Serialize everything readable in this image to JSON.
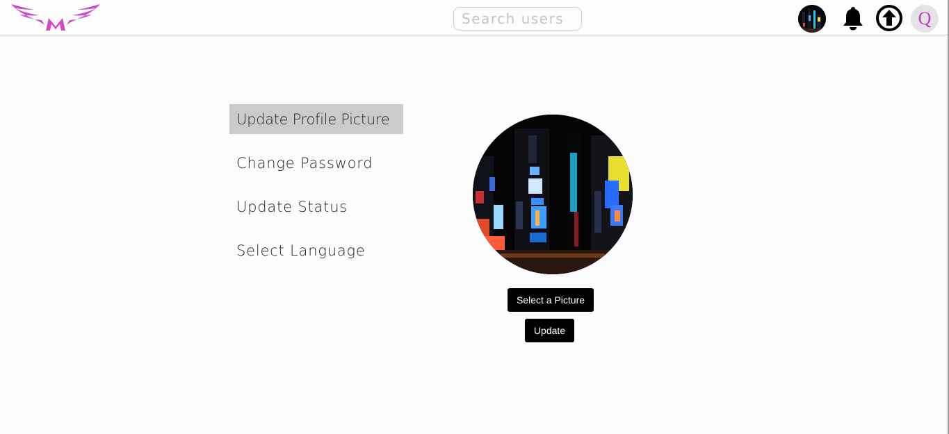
{
  "header": {
    "logo_icon": "winged-m-logo",
    "search": {
      "placeholder": "Search users",
      "value": ""
    },
    "icons": [
      "profile-avatar",
      "bell-icon",
      "upload-arrow-icon"
    ],
    "user_initial": "Q",
    "brand_color": "#c84fc8"
  },
  "menu": {
    "items": [
      {
        "label": "Update Profile Picture",
        "active": true
      },
      {
        "label": "Change Password",
        "active": false
      },
      {
        "label": "Update Status",
        "active": false
      },
      {
        "label": "Select Language",
        "active": false
      }
    ]
  },
  "profile": {
    "image": "city-night-photo",
    "select_label": "Select a Picture",
    "update_label": "Update"
  }
}
